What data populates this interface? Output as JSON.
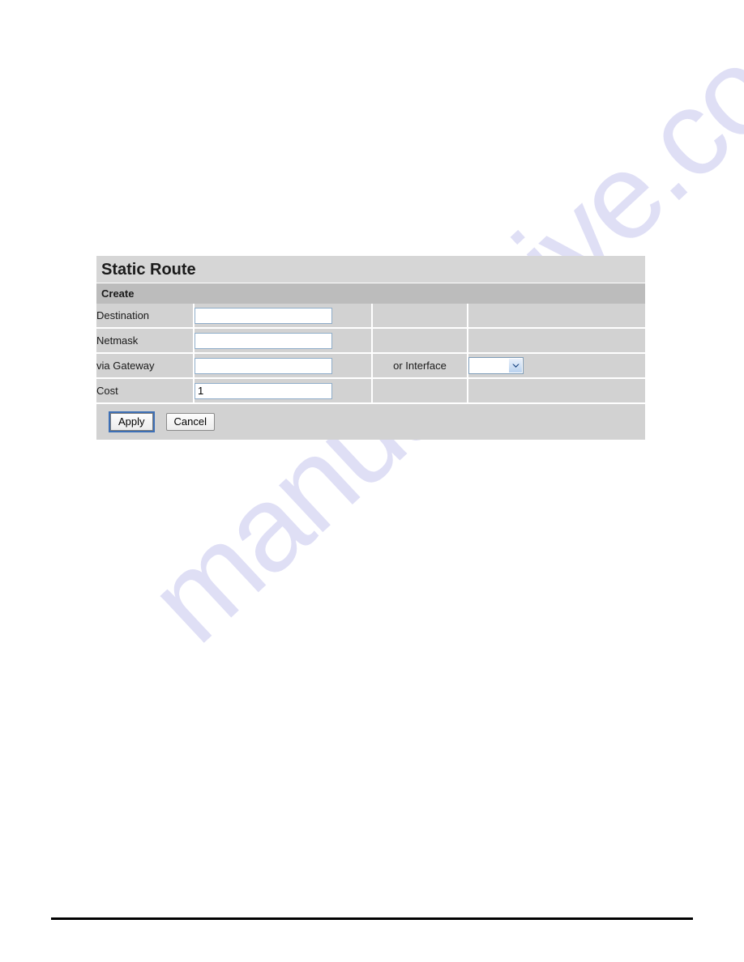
{
  "page": {
    "title": "Static Route",
    "section_title": "Create"
  },
  "watermark": {
    "text": "manualshive.com",
    "color": "#ccccf0"
  },
  "form": {
    "rows": [
      {
        "label": "Destination",
        "input_value": "",
        "input_placeholder": ""
      },
      {
        "label": "Netmask",
        "input_value": "",
        "input_placeholder": ""
      },
      {
        "label": "via Gateway",
        "input_value": "",
        "input_placeholder": "",
        "mid_label": "or Interface",
        "select_value": "",
        "select_options": [
          ""
        ]
      },
      {
        "label": "Cost",
        "input_value": "1",
        "input_placeholder": ""
      }
    ]
  },
  "actions": {
    "apply_label": "Apply",
    "cancel_label": "Cancel"
  },
  "colors": {
    "title_bar": "#d6d6d6",
    "subtitle_bar": "#bcbcbc",
    "cell": "#d2d2d2",
    "label_cell": "#e6e6bf",
    "input_border": "#8fadc9",
    "focus_ring": "#3d6fb5"
  }
}
